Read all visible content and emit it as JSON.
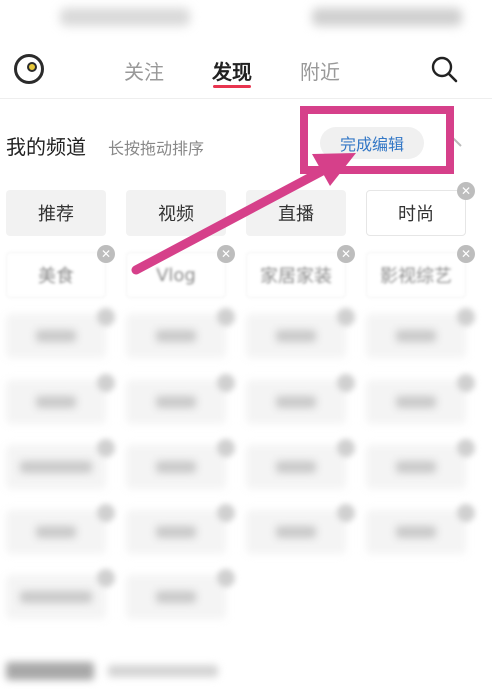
{
  "nav": {
    "tabs": [
      {
        "label": "关注",
        "active": false
      },
      {
        "label": "发现",
        "active": true
      },
      {
        "label": "附近",
        "active": false
      }
    ]
  },
  "channel": {
    "title": "我的频道",
    "hint": "长按拖动排序",
    "done_label": "完成编辑"
  },
  "chips": [
    {
      "label": "推荐",
      "style": "filled",
      "removable": false
    },
    {
      "label": "视频",
      "style": "filled",
      "removable": false
    },
    {
      "label": "直播",
      "style": "filled",
      "removable": false
    },
    {
      "label": "时尚",
      "style": "outline",
      "removable": true
    },
    {
      "label": "美食",
      "style": "outline",
      "removable": true
    },
    {
      "label": "Vlog",
      "style": "outline",
      "removable": true
    },
    {
      "label": "家居家装",
      "style": "outline",
      "removable": true
    },
    {
      "label": "影视综艺",
      "style": "outline",
      "removable": true
    }
  ],
  "colors": {
    "accent": "#e8344f",
    "link": "#3478c6",
    "annotation": "#d6408a"
  },
  "icons": {
    "logo": "logo-icon",
    "search": "search-icon",
    "collapse": "chevron-up-icon",
    "remove": "close-icon"
  }
}
